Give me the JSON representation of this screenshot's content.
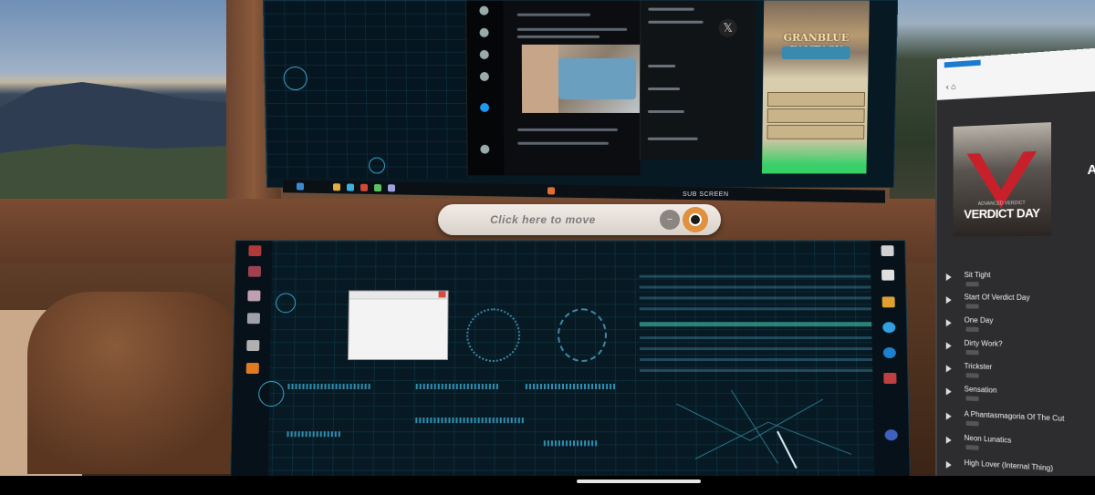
{
  "move_bar": {
    "label": "Click here to move",
    "minimize_glyph": "–",
    "icon": "recenter-icon"
  },
  "sub_screen_label": "SUB SCREEN",
  "game_logo": "GRANBLUE FANTASY",
  "music": {
    "album_title": "VERDICT DAY",
    "album_subtitle": "ADVANCED VERDICT",
    "artist_initial": "A",
    "tracks": [
      "Sit Tight",
      "Start Of Verdict Day",
      "One Day",
      "Dirty Work?",
      "Trickster",
      "Sensation",
      "A Phantasmagoria Of The Cut",
      "Neon Lunatics",
      "High Lover (Internal Thing)"
    ]
  },
  "colors": {
    "accent_hud": "#36a6c8",
    "move_bar_bg": "#ebe6df",
    "move_button": "#e0903e",
    "social_link": "#1d9bf0"
  }
}
